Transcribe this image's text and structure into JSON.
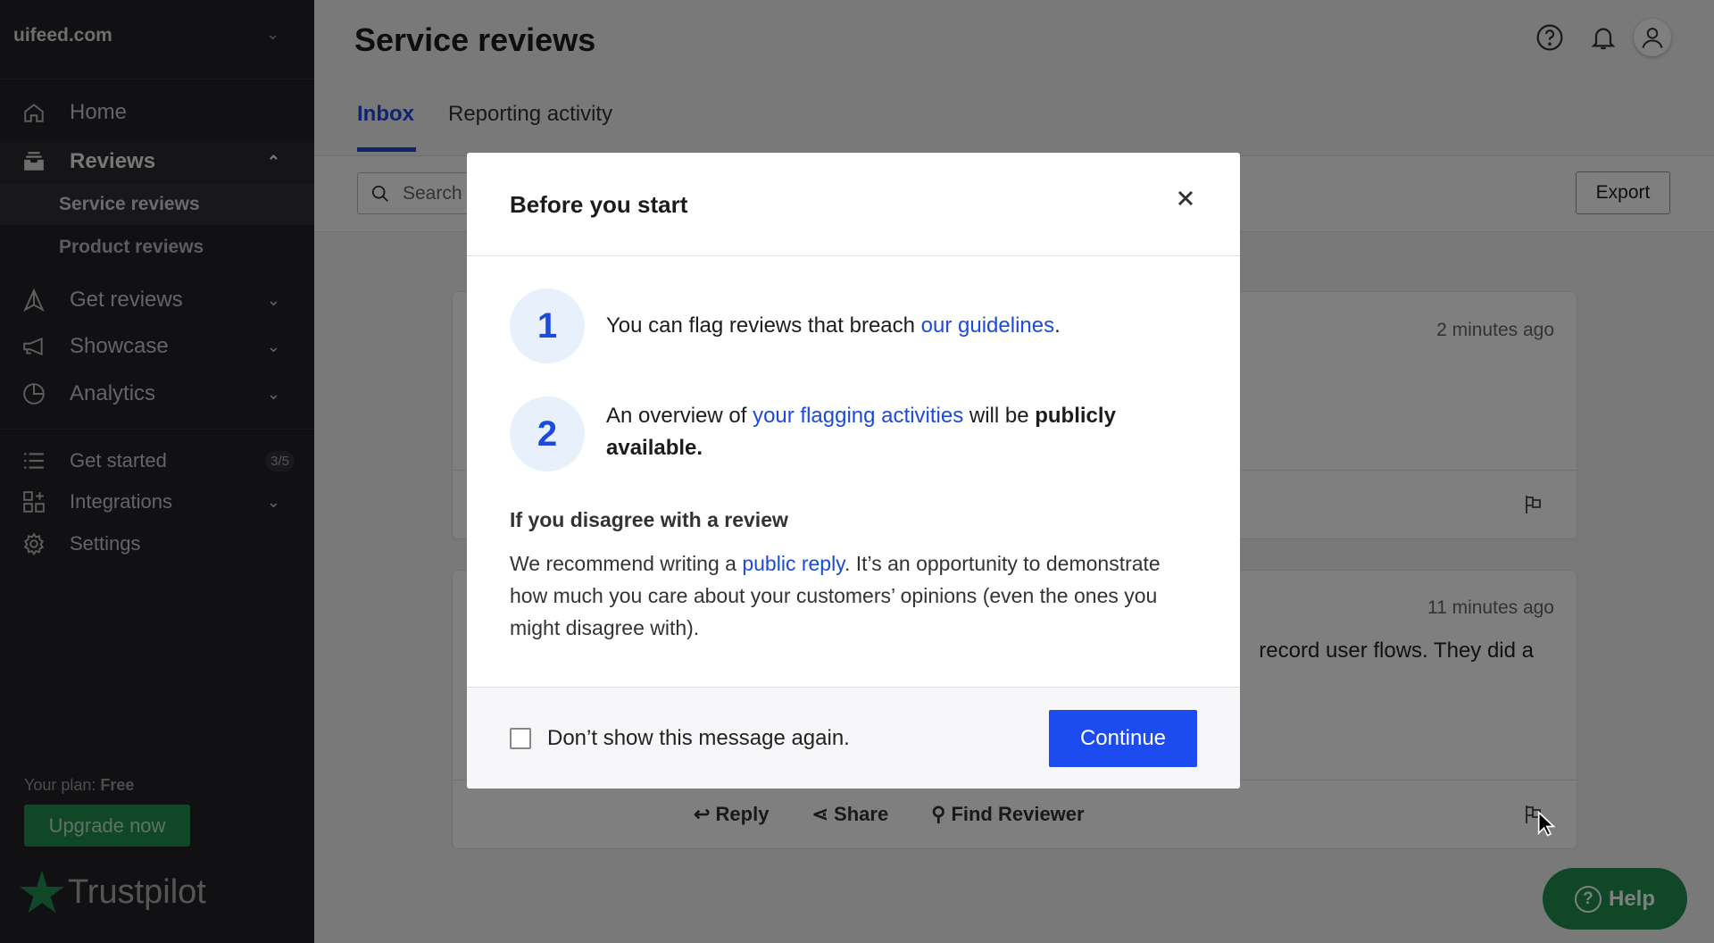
{
  "sidebar": {
    "site": "uifeed.com",
    "items": [
      {
        "label": "Home",
        "icon": "home-icon"
      },
      {
        "label": "Reviews",
        "icon": "inbox-icon",
        "expanded": true
      },
      {
        "label": "Get reviews",
        "icon": "send-icon"
      },
      {
        "label": "Showcase",
        "icon": "megaphone-icon"
      },
      {
        "label": "Analytics",
        "icon": "pie-chart-icon"
      },
      {
        "label": "Get started",
        "icon": "list-icon",
        "badge": "3/5"
      },
      {
        "label": "Integrations",
        "icon": "apps-icon"
      },
      {
        "label": "Settings",
        "icon": "gear-icon"
      }
    ],
    "subitems": [
      "Service reviews",
      "Product reviews"
    ],
    "plan_label": "Your plan:",
    "plan_value": "Free",
    "upgrade": "Upgrade now",
    "logo": "Trustpilot"
  },
  "header": {
    "title": "Service reviews",
    "tabs": [
      "Inbox",
      "Reporting activity"
    ],
    "active_tab": "Inbox"
  },
  "toolbar": {
    "search_placeholder": "Search",
    "export": "Export"
  },
  "reviews": [
    {
      "time": "2 minutes ago",
      "text": ""
    },
    {
      "time": "11 minutes ago",
      "text": "record user flows. They did a",
      "actions": [
        "Reply",
        "Share",
        "Find Reviewer"
      ]
    }
  ],
  "help_button": "Help",
  "modal": {
    "title": "Before you start",
    "step1": {
      "num": "1",
      "pre": "You can flag reviews that breach ",
      "link": "our guidelines",
      "post": "."
    },
    "step2": {
      "num": "2",
      "pre": "An overview of ",
      "link": "your flagging activities",
      "mid": " will be ",
      "bold": "publicly available."
    },
    "subheading": "If you disagree with a review",
    "para": {
      "pre": "We recommend writing a ",
      "link": "public reply",
      "post": ". It’s an opportunity to demonstrate how much you care about your customers’ opinions (even the ones you might disagree with)."
    },
    "checkbox": "Don’t show this message again.",
    "checkbox_checked": false,
    "continue": "Continue"
  },
  "colors": {
    "primary": "#1c4bf0",
    "brand_green": "#1f8f4e",
    "link": "#1c4bd9"
  }
}
